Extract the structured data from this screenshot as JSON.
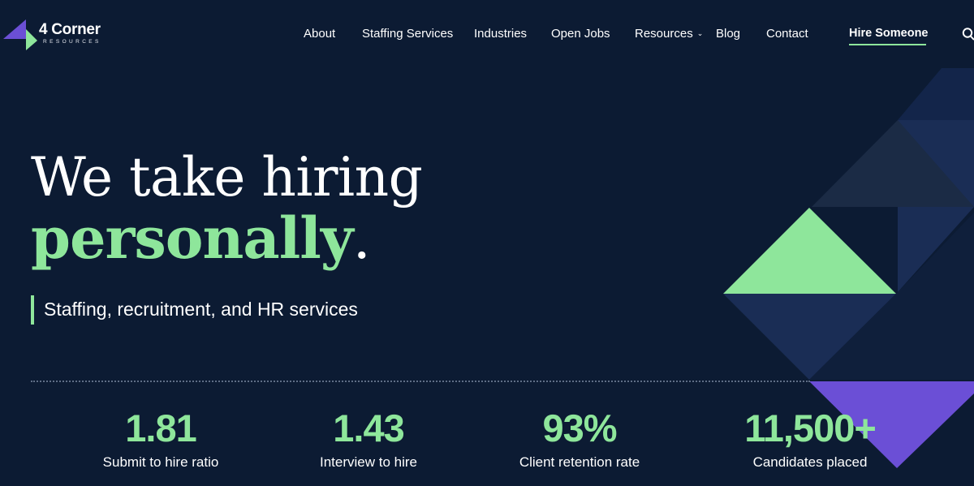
{
  "brand": {
    "name": "4 Corner",
    "subtitle": "RESOURCES"
  },
  "nav": {
    "items": [
      {
        "label": "About"
      },
      {
        "label": "Staffing Services"
      },
      {
        "label": "Industries"
      },
      {
        "label": "Open Jobs"
      },
      {
        "label": "Resources",
        "has_dropdown": true,
        "chevron": "⌄"
      },
      {
        "label": "Blog"
      },
      {
        "label": "Contact"
      }
    ],
    "cta_label": "Hire Someone",
    "search_icon": "search-icon"
  },
  "hero": {
    "headline_line1": "We take hiring",
    "headline_highlight": "personally",
    "headline_punct": ".",
    "tagline": "Staffing, recruitment, and HR services"
  },
  "stats": [
    {
      "value": "1.81",
      "label": "Submit to hire ratio"
    },
    {
      "value": "1.43",
      "label": "Interview to hire"
    },
    {
      "value": "93%",
      "label": "Client retention rate"
    },
    {
      "value": "11,500+",
      "label": "Candidates placed"
    }
  ],
  "colors": {
    "background": "#0c1b33",
    "accent_green": "#8ee69b",
    "accent_purple": "#6b4fd6",
    "shape_navy": "#1a2d55",
    "shape_slate": "#1b2b45"
  }
}
